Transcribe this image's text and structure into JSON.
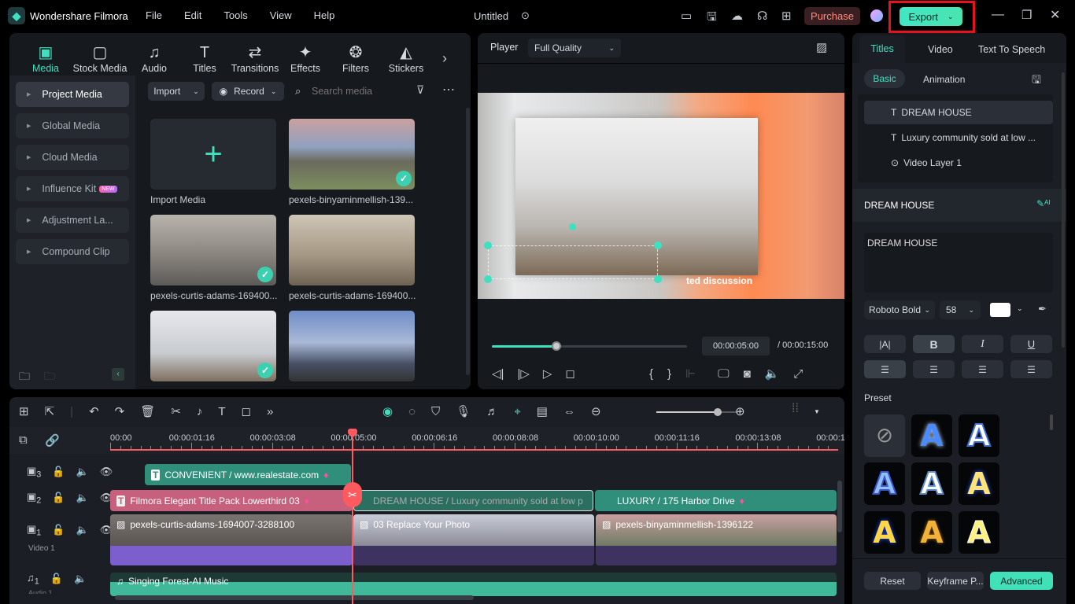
{
  "app": {
    "name": "Wondershare Filmora",
    "menu": [
      "File",
      "Edit",
      "Tools",
      "View",
      "Help"
    ],
    "project_title": "Untitled",
    "purchase": "Purchase",
    "export": "Export"
  },
  "media_tabs": [
    {
      "label": "Media",
      "icon": "media-icon",
      "g": "▣"
    },
    {
      "label": "Stock Media",
      "icon": "stock-media-icon",
      "g": "▢"
    },
    {
      "label": "Audio",
      "icon": "audio-icon",
      "g": "♫"
    },
    {
      "label": "Titles",
      "icon": "titles-icon",
      "g": "T"
    },
    {
      "label": "Transitions",
      "icon": "transitions-icon",
      "g": "⇄"
    },
    {
      "label": "Effects",
      "icon": "effects-icon",
      "g": "✦"
    },
    {
      "label": "Filters",
      "icon": "filters-icon",
      "g": "❂"
    },
    {
      "label": "Stickers",
      "icon": "stickers-icon",
      "g": "◭"
    }
  ],
  "sidebar": [
    {
      "label": "Project Media"
    },
    {
      "label": "Global Media"
    },
    {
      "label": "Cloud Media"
    },
    {
      "label": "Influence Kit",
      "badge": "NEW"
    },
    {
      "label": "Adjustment La..."
    },
    {
      "label": "Compound Clip"
    }
  ],
  "media_toolbar": {
    "import": "Import",
    "record": "Record",
    "search_placeholder": "Search media"
  },
  "media_items": [
    {
      "label": "Import Media"
    },
    {
      "label": "pexels-binyaminmellish-139..."
    },
    {
      "label": "pexels-curtis-adams-169400..."
    },
    {
      "label": "pexels-curtis-adams-169400..."
    },
    {
      "label": ""
    },
    {
      "label": ""
    }
  ],
  "player": {
    "label": "Player",
    "quality": "Full Quality",
    "current_time": "00:00:05:00",
    "total_time": "/ 00:00:15:00",
    "progress": 0.33,
    "overlay_text": "ted discussion"
  },
  "right_panel": {
    "tabs": [
      "Titles",
      "Video",
      "Text To Speech"
    ],
    "subtabs": [
      "Basic",
      "Animation"
    ],
    "layers": [
      "DREAM HOUSE",
      "Luxury community sold at low ...",
      "Video Layer 1"
    ],
    "section_title": "DREAM HOUSE",
    "text_value": "DREAM HOUSE",
    "font": "Roboto Bold",
    "size": "58",
    "color": "#ffffff",
    "preset_label": "Preset",
    "buttons": {
      "reset": "Reset",
      "keyframe": "Keyframe P...",
      "advanced": "Advanced"
    }
  },
  "timeline": {
    "ruler": [
      "00:00",
      "00:00:01:16",
      "00:00:03:08",
      "00:00:05:00",
      "00:00:06:16",
      "00:00:08:08",
      "00:00:10:00",
      "00:00:11:16",
      "00:00:13:08",
      "00:00:1"
    ],
    "tracks": [
      {
        "id": "3"
      },
      {
        "id": "2"
      },
      {
        "id": "1",
        "name": "Video 1"
      },
      {
        "id": "1",
        "name": "Audio 1"
      }
    ],
    "clips": {
      "t3": "CONVENIENT / www.realestate.com",
      "t2a": "Filmora Elegant Title Pack Lowerthird 03",
      "t2b": "DREAM HOUSE / Luxury community sold at low p",
      "t2c": "LUXURY / 175 Harbor Drive",
      "v1a": "pexels-curtis-adams-1694007-3288100",
      "v1b": "03 Replace Your Photo",
      "v1c": "pexels-binyaminmellish-1396122",
      "a1": "Singing Forest-AI Music"
    },
    "zoom_level": 0.75
  },
  "colors": {
    "accent": "#3fe0c0",
    "export_bg": "#40e6c4",
    "highlight": "#e8121f",
    "playhead": "#ff5a5f",
    "title_clip": "#2f8f7b",
    "pink_clip": "#c7607c",
    "video_clip": "#7c5fcc",
    "audio": "#3fb99a"
  }
}
